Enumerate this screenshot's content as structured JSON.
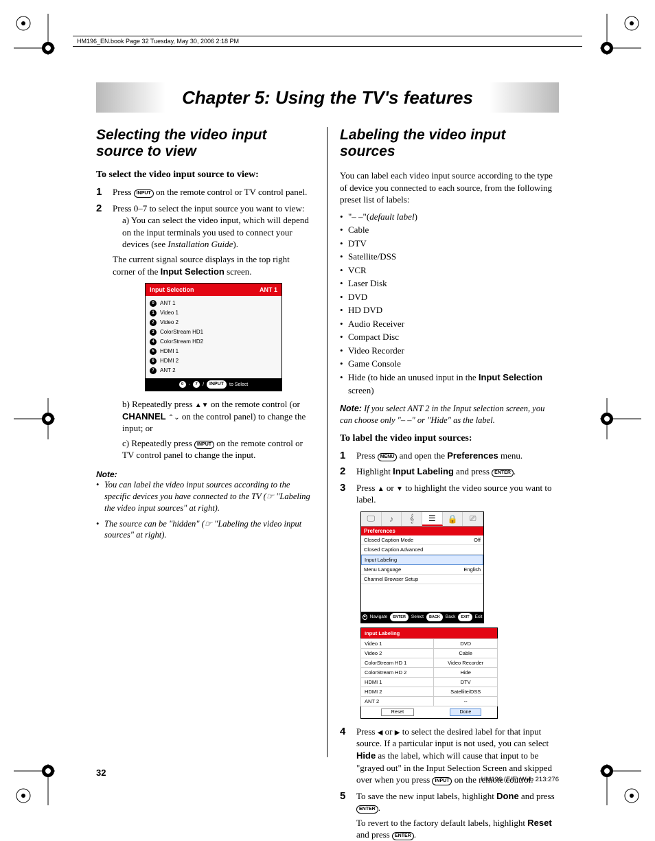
{
  "header": {
    "filename": "HM196_EN.book  Page 32  Tuesday, May 30, 2006  2:18 PM"
  },
  "chapter": "Chapter 5: Using the TV's features",
  "left": {
    "title": "Selecting the video input source to view",
    "subhead": "To select the video input source to view:",
    "step1": "Press",
    "step1b": "on the remote control or TV control panel.",
    "input_btn": "INPUT",
    "step2_intro": "Press 0–7 to select the input source you want to view:",
    "step2_a": "a) You can select the video input, which will depend on the input terminals you used to connect your devices (see ",
    "step2_a_link": "Installation Guide",
    "step2_a_end": ").",
    "step2_a_after": "The current signal source displays in the top right corner of the ",
    "step2_a_after_b": "Input Selection",
    "step2_a_after_end": " screen.",
    "step2_b_pre": "b) Repeatedly press ",
    "step2_b_mid": " on the remote control (or ",
    "step2_b_chan": "CHANNEL",
    "step2_b_end": " on the control panel) to change the input; or",
    "step2_c_pre": "c) Repeatedly press ",
    "step2_c_end": " on the remote control or TV control panel to change the input.",
    "note_head": "Note:",
    "note1": "You can label the video input sources according to the specific devices you have connected to the TV (☞ \"Labeling the video input sources\" at right).",
    "note2": "The source can be \"hidden\" (☞ \"Labeling the video input sources\" at right).",
    "isp": {
      "title": "Input Selection",
      "status": "ANT 1",
      "rows": [
        "ANT 1",
        "Video 1",
        "Video 2",
        "ColorStream HD1",
        "ColorStream HD2",
        "HDMI 1",
        "HDMI 2",
        "ANT 2"
      ],
      "foot_pre": "0 - 7  / ",
      "foot_btn": "INPUT",
      "foot_post": " to Select"
    }
  },
  "right": {
    "title": "Labeling the video input sources",
    "intro": "You can label each video input source according to the type of device you connected to each source, from the following preset list of labels:",
    "label_first_pre": "\"– –\"(",
    "label_first_i": "default label",
    "label_first_post": ")",
    "labels": [
      "Cable",
      "DTV",
      "Satellite/DSS",
      "VCR",
      "Laser Disk",
      "DVD",
      "HD DVD",
      "Audio Receiver",
      "Compact Disc",
      "Video Recorder",
      "Game Console"
    ],
    "label_hide_pre": "Hide (to hide an unused input in the ",
    "label_hide_b": "Input Selection",
    "label_hide_post": " screen)",
    "note_head": "Note:",
    "note_text": " If you select ANT 2 in the Input selection screen, you can choose only \"– –\" or \"Hide\" as the label.",
    "subhead": "To label the video input sources:",
    "step1_pre": "Press ",
    "menu_btn": "MENU",
    "step1_mid": " and open the ",
    "step1_b": "Preferences",
    "step1_end": " menu.",
    "step2_pre": "Highlight ",
    "step2_b": "Input Labeling",
    "step2_mid": " and press ",
    "enter_btn": "ENTER",
    "step2_end": ".",
    "step3_pre": "Press ",
    "step3_mid": " or ",
    "step3_end": " to highlight the video source you want to label.",
    "prefs": {
      "head": "Preferences",
      "r1l": "Closed Caption Mode",
      "r1r": "Off",
      "r2l": "Closed Caption Advanced",
      "r3l": "Input Labeling",
      "r4l": "Menu Language",
      "r4r": "English",
      "r5l": "Channel Browser Setup",
      "foot_nav": "Navigate",
      "foot_sel": "Select",
      "foot_back": "Back",
      "foot_exit": "Exit",
      "foot_enter": "ENTER",
      "foot_backbtn": "BACK",
      "foot_exitbtn": "EXIT"
    },
    "il": {
      "head": "Input Labeling",
      "rows": [
        {
          "k": "Video 1",
          "v": "DVD"
        },
        {
          "k": "Video 2",
          "v": "Cable"
        },
        {
          "k": "ColorStream HD 1",
          "v": "Video Recorder"
        },
        {
          "k": "ColorStream HD 2",
          "v": "Hide"
        },
        {
          "k": "HDMI 1",
          "v": "DTV"
        },
        {
          "k": "HDMI 2",
          "v": "Satellite/DSS"
        },
        {
          "k": "ANT 2",
          "v": "--"
        }
      ],
      "reset": "Reset",
      "done": "Done"
    },
    "step4_pre": "Press ",
    "step4_mid1": " or ",
    "step4_mid2": " to select the desired label for that input source. If a particular input is not used, you can select ",
    "step4_hide": "Hide",
    "step4_mid3": " as the label, which will cause that input to be \"grayed out\" in the Input Selection Screen and skipped over when you press ",
    "step4_end": " on the remote control.",
    "step5_pre": "To save the new input labels, highlight ",
    "step5_done": "Done",
    "step5_mid": " and press ",
    "step5_end": ".",
    "step5_b_pre": "To revert to the factory default labels, highlight ",
    "step5_b_reset": "Reset",
    "step5_b_mid": " and press ",
    "step5_b_end": "."
  },
  "page_num": "32",
  "footer_id": "HM196 (E/F) Web 213:276"
}
